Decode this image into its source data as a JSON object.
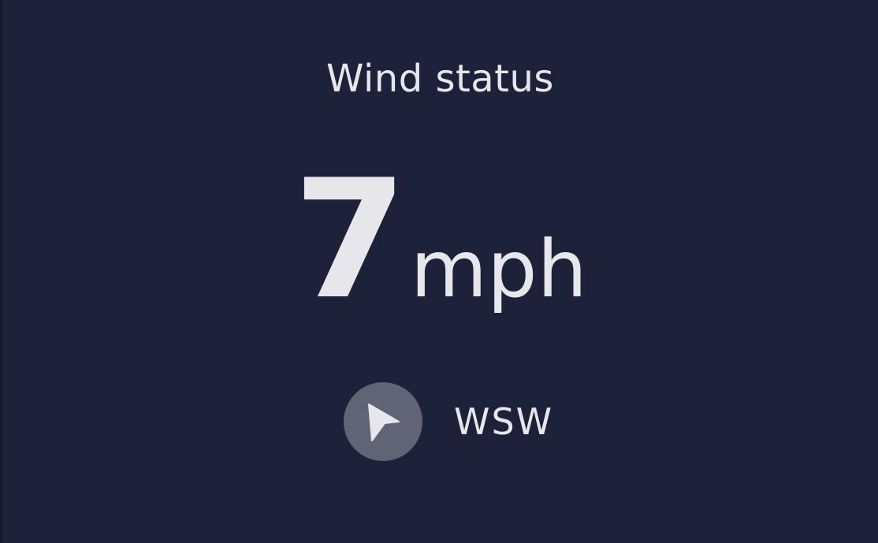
{
  "wind": {
    "title": "Wind status",
    "speed_value": "7",
    "speed_unit": "mph",
    "direction_label": "WSW",
    "compass_icon": "navigation-arrow-icon"
  },
  "colors": {
    "page_bg": "#15172b",
    "card_bg": "#1e213a",
    "text": "#e7e7eb",
    "compass_bg": "#616475"
  }
}
